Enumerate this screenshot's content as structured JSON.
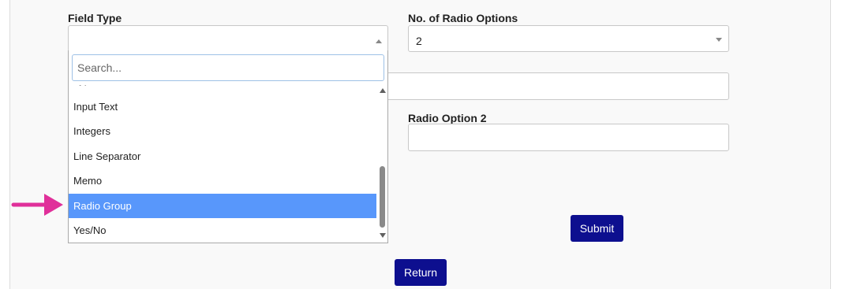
{
  "form": {
    "field_type_label": "Field Type",
    "radio_options_label": "No. of Radio Options",
    "radio_options_value": "2",
    "radio_option_2_label": "Radio Option 2",
    "submit_label": "Submit",
    "return_label": "Return"
  },
  "dropdown": {
    "search_placeholder": "Search...",
    "options": [
      "Input Text",
      "Integers",
      "Line Separator",
      "Memo",
      "Radio Group",
      "Yes/No"
    ],
    "selected": "Radio Group"
  },
  "annotation": {
    "arrow_color": "#e0309a"
  },
  "colors": {
    "button": "#0d0f8f",
    "highlight": "#5897fb"
  }
}
